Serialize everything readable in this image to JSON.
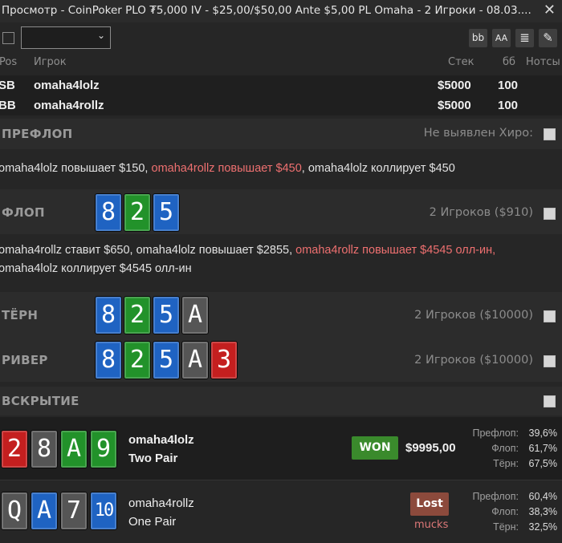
{
  "window": {
    "title": "Просмотр - CoinPoker PLO ₮5,000 IV - $25,00/$50,00 Ante $5,00 PL Omaha - 2 Игроки - 08.03....",
    "close_glyph": "✕"
  },
  "toolbar": {
    "dropdown_value": "",
    "btn_bb": "bb",
    "btn_font": "AA",
    "btn_list": "≣",
    "btn_edit": "✎"
  },
  "columns": {
    "pos": "Pos",
    "player": "Игрок",
    "stack": "Стек",
    "bb": "бб",
    "notes": "Нотсы"
  },
  "players": [
    {
      "pos": "SB",
      "name": "omaha4lolz",
      "stack": "$5000",
      "bb": "100"
    },
    {
      "pos": "BB",
      "name": "omaha4rollz",
      "stack": "$5000",
      "bb": "100"
    }
  ],
  "preflop": {
    "label": "ПРЕФЛОП",
    "info": "Не выявлен Хиро:",
    "actions": {
      "a1": "omaha4lolz повышает $150, ",
      "a2": "omaha4rollz повышает $450",
      "a3": ", omaha4lolz коллирует $450"
    }
  },
  "flop": {
    "label": "ФЛОП",
    "info": "2 Игроков ($910)",
    "cards": [
      "8",
      "2",
      "5"
    ],
    "actions": {
      "l1a": "omaha4rollz ставит $650, omaha4lolz повышает $2855, ",
      "l1b": "omaha4rollz повышает $4545 олл-ин,",
      "l2": "omaha4lolz коллирует $4545 олл-ин"
    }
  },
  "turn": {
    "label": "ТЁРН",
    "info": "2 Игроков ($10000)",
    "cards": [
      "8",
      "2",
      "5",
      "A"
    ]
  },
  "river": {
    "label": "РИВЕР",
    "info": "2 Игроков ($10000)",
    "cards": [
      "8",
      "2",
      "5",
      "A",
      "3"
    ]
  },
  "showdown": {
    "label": "ВСКРЫТИЕ",
    "players": [
      {
        "cards": [
          "2",
          "8",
          "A",
          "9"
        ],
        "name": "omaha4lolz",
        "hand": "Two Pair",
        "result": "WON",
        "amount": "$9995,00",
        "equity_labels": [
          "Префлоп:",
          "Флоп:",
          "Тёрн:"
        ],
        "equity_values": [
          "39,6%",
          "61,7%",
          "67,5%"
        ]
      },
      {
        "cards": [
          "Q",
          "A",
          "7",
          "10"
        ],
        "name": "omaha4rollz",
        "hand": "One Pair",
        "result": "Lost",
        "status": "mucks",
        "equity_labels": [
          "Префлоп:",
          "Флоп:",
          "Тёрн:"
        ],
        "equity_values": [
          "60,4%",
          "38,3%",
          "32,5%"
        ]
      }
    ]
  },
  "colors": {
    "card_blue": "#1f63c2",
    "card_green": "#22922a",
    "card_gray": "#555555",
    "card_red": "#c41f1f",
    "won_badge": "#3a8a2c",
    "lost_badge": "#8c4a3c",
    "highlight_text": "#ee7070"
  }
}
